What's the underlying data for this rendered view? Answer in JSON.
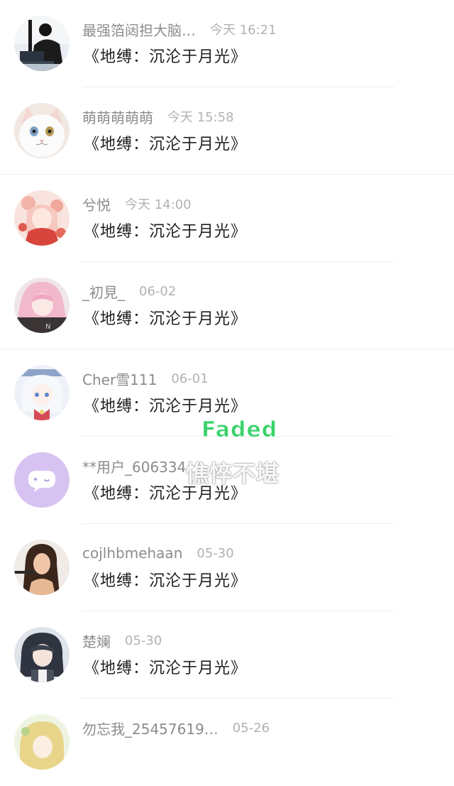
{
  "comments": [
    {
      "user": "最强箔闼担大脑…",
      "time": "今天 16:21",
      "content": "《地缚：沉沦于月光》",
      "avatar": "dark-figure-avatar"
    },
    {
      "user": "萌萌萌萌萌",
      "time": "今天 15:58",
      "content": "《地缚：沉沦于月光》",
      "avatar": "white-cat-avatar"
    },
    {
      "user": "兮悦",
      "time": "今天 14:00",
      "content": "《地缚：沉沦于月光》",
      "avatar": "anime-girl-red-avatar"
    },
    {
      "user": "_初見_",
      "time": "06-02",
      "content": "《地缚：沉沦于月光》",
      "avatar": "pink-hair-avatar"
    },
    {
      "user": "Cher雪111",
      "time": "06-01",
      "content": "《地缚：沉沦于月光》",
      "avatar": "white-hair-anime-avatar"
    },
    {
      "user": "**用户_606334",
      "time": "",
      "content": "《地缚：沉沦于月光》",
      "avatar": "chat-bubble-avatar"
    },
    {
      "user": "cojlhbmehaan",
      "time": "05-30",
      "content": "《地缚：沉沦于月光》",
      "avatar": "woman-portrait-avatar"
    },
    {
      "user": "楚斓",
      "time": "05-30",
      "content": "《地缚：沉沦于月光》",
      "avatar": "dark-hair-anime-avatar"
    },
    {
      "user": "勿忘我_25457619…",
      "time": "05-26",
      "content": "",
      "avatar": "blonde-anime-avatar"
    }
  ],
  "watermark": {
    "brand": "Faded",
    "text": "憔悴不堪"
  },
  "colors": {
    "username": "#8c8c8c",
    "time": "#b2b2b2",
    "content": "#1f1f1f",
    "divider": "#efefef",
    "brand": "#3ad16a",
    "chat_avatar_bg": "#d6c3f2"
  }
}
